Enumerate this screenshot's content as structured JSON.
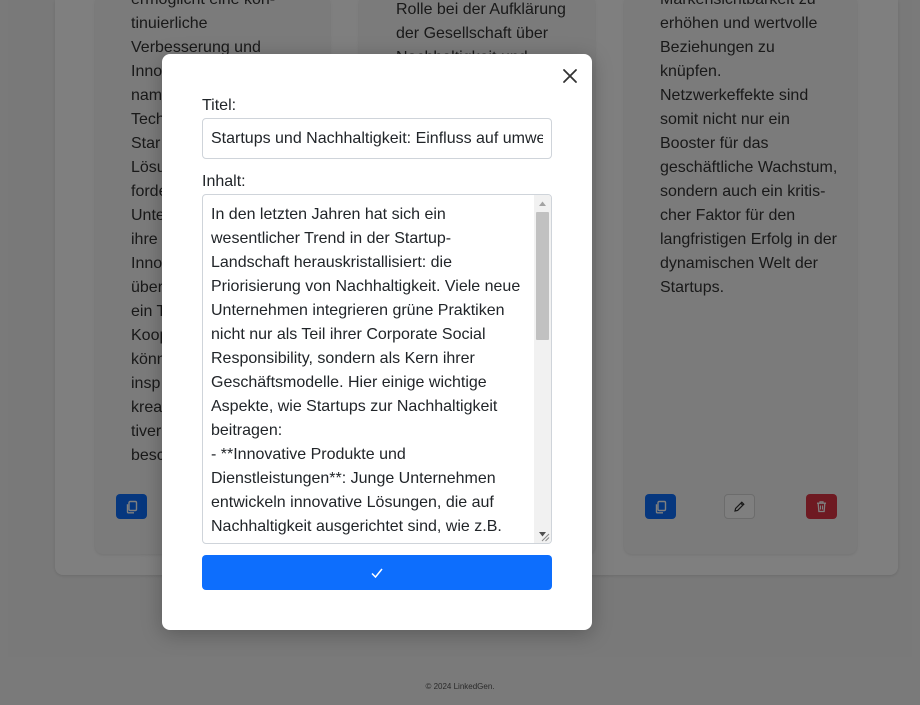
{
  "background": {
    "cards": [
      {
        "text": "ermöglicht eine kon-\ntinuierliche\nVerbesserung und\nInno\nnam\nTech\nStar\nLösu\nforde\nUnte\nihre\nInno\nüber\nein T\nKoop\nkönn\ninsp\nkrea\ntiver\nbesc"
      },
      {
        "text": "Rolle bei der Aufklärung\nder Gesellschaft über\nNachhaltigkeit und"
      },
      {
        "text": "Markensichtbarkeit zu\nerhöhen und wertvolle\nBeziehungen zu\nknüpfen.\nNetzwerkeffekte sind\nsomit nicht nur ein\nBooster für das\ngeschäftliche Wachstum,\nsondern auch ein kritis-\ncher Faktor für den\nlangfristigen Erfolg in der\ndynamischen Welt der\nStartups."
      }
    ],
    "footer": "© 2024 LinkedGen."
  },
  "modal": {
    "title_label": "Titel:",
    "title_value": "Startups und Nachhaltigkeit: Einfluss auf umwelt",
    "content_label": "Inhalt:",
    "content_value": "In den letzten Jahren hat sich ein\nwesentlicher Trend in der Startup-\nLandschaft herauskristallisiert: die\nPriorisierung von Nachhaltigkeit. Viele neue\nUnternehmen integrieren grüne Praktiken\nnicht nur als Teil ihrer Corporate Social\nResponsibility, sondern als Kern ihrer\nGeschäftsmodelle. Hier einige wichtige\nAspekte, wie Startups zur Nachhaltigkeit\nbeitragen:\n- **Innovative Produkte und\nDienstleistungen**: Junge Unternehmen\nentwickeln innovative Lösungen, die auf\nNachhaltigkeit ausgerichtet sind, wie z.B.",
    "scroll_position": 0.0
  },
  "colors": {
    "primary": "#0d6efd",
    "danger": "#dc3545",
    "backdrop": "rgba(0,0,0,0.5)"
  },
  "icons": {
    "copy": "copy-icon",
    "edit": "pencil-icon",
    "delete": "trash-icon",
    "close": "close-icon",
    "submit": "checkmark-icon"
  }
}
